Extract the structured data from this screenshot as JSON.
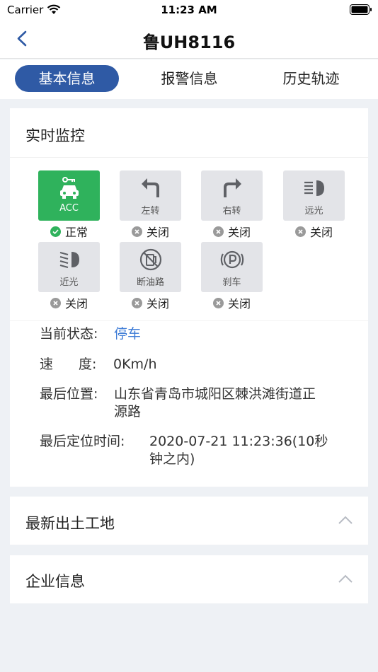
{
  "status_bar": {
    "carrier": "Carrier",
    "time": "11:23 AM"
  },
  "nav": {
    "title": "鲁UH8116"
  },
  "tabs": [
    {
      "label": "基本信息",
      "active": true
    },
    {
      "label": "报警信息",
      "active": false
    },
    {
      "label": "历史轨迹",
      "active": false
    }
  ],
  "monitor": {
    "title": "实时监控",
    "tiles": [
      {
        "label": "ACC",
        "icon": "acc-car-icon",
        "status": "正常",
        "on": true
      },
      {
        "label": "左转",
        "icon": "turn-left-icon",
        "status": "关闭",
        "on": false
      },
      {
        "label": "右转",
        "icon": "turn-right-icon",
        "status": "关闭",
        "on": false
      },
      {
        "label": "远光",
        "icon": "high-beam-icon",
        "status": "关闭",
        "on": false
      },
      {
        "label": "近光",
        "icon": "low-beam-icon",
        "status": "关闭",
        "on": false
      },
      {
        "label": "断油路",
        "icon": "fuel-cut-icon",
        "status": "关闭",
        "on": false
      },
      {
        "label": "刹车",
        "icon": "parking-brake-icon",
        "status": "关闭",
        "on": false
      }
    ],
    "info": {
      "state_label": "当前状态:",
      "state_value": "停车",
      "speed_label_a": "速",
      "speed_label_b": "度:",
      "speed_value": "0Km/h",
      "location_label": "最后位置:",
      "location_line1": "山东省青岛市城阳区棘洪滩街道正",
      "location_line2": "源路",
      "time_label": "最后定位时间:",
      "time_line1": "2020-07-21 11:23:36(10秒",
      "time_line2": "钟之内)"
    }
  },
  "sections": [
    {
      "title": "最新出土工地",
      "expanded": true
    },
    {
      "title": "企业信息",
      "expanded": true
    }
  ],
  "colors": {
    "primary": "#2f5aa5",
    "active_green": "#2fb25c",
    "link_blue": "#3d7bd6",
    "inactive_grey": "#e3e4e8"
  }
}
